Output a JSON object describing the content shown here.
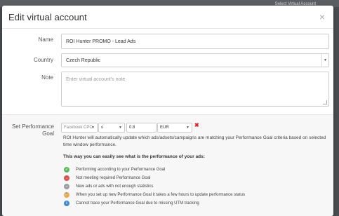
{
  "backdrop": {
    "hint_text": "Select Virtual Account"
  },
  "modal": {
    "title": "Edit virtual account",
    "close_glyph": "×"
  },
  "form": {
    "name": {
      "label": "Name",
      "value": "ROI Hunter PROMO - Lead Ads"
    },
    "country": {
      "label": "Country",
      "value": "Czech Republic"
    },
    "note": {
      "label": "Note",
      "placeholder": "Enter virtual account's note",
      "value": ""
    }
  },
  "performance_goal": {
    "label": "Set Performance Goal",
    "metric": "Facebook CPC",
    "operator": "≤",
    "threshold": "0.8",
    "currency": "EUR",
    "remove_glyph": "✖",
    "description": "ROI Hunter will automatically update which ads/adsets/campaigns are matching your Performance Goal criteria based on selected time window performance.",
    "legend_heading": "This way you can easily see what is the performance of your ads:",
    "legend": [
      {
        "icon": "thumbs-up-icon",
        "color": "#5cb85c",
        "glyph": "✓",
        "text": "Performing according to your Performance Goal"
      },
      {
        "icon": "arrow-right-icon",
        "color": "#d9534f",
        "glyph": "→",
        "text": "Not meeting required Performance Goal"
      },
      {
        "icon": "minus-icon",
        "color": "#9aa0a6",
        "glyph": "–",
        "text": "New ads or ads with not enough statistics"
      },
      {
        "icon": "hourglass-icon",
        "color": "#f0ad4e",
        "glyph": "⌛",
        "text": "When you set up new Performance Goal it takes a few hours to update performance status"
      },
      {
        "icon": "info-icon",
        "color": "#428bca",
        "glyph": "i",
        "text": "Cannot trace your Performance Goal due to missing UTM tracking"
      }
    ]
  }
}
